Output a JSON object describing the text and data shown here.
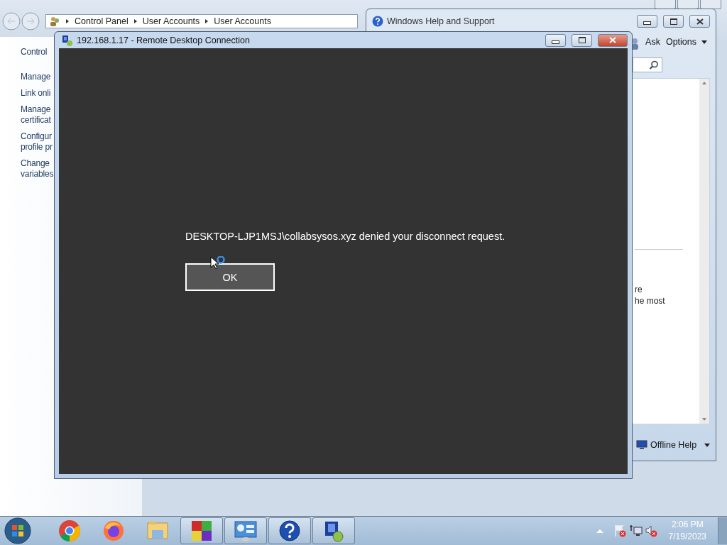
{
  "control_panel": {
    "breadcrumb": [
      "Control Panel",
      "User Accounts",
      "User Accounts"
    ],
    "tasks": [
      {
        "lines": [
          "Control"
        ]
      },
      {
        "lines": [
          "Manage"
        ]
      },
      {
        "lines": [
          "Link onli"
        ]
      },
      {
        "lines": [
          "Manage",
          "certificat"
        ]
      },
      {
        "lines": [
          "Configur",
          "profile pr"
        ]
      },
      {
        "lines": [
          "Change",
          "variables"
        ]
      }
    ]
  },
  "help_window": {
    "title": "Windows Help and Support",
    "toolbar": [
      "Ask",
      "Options"
    ],
    "content_lines": [
      "re",
      "he most"
    ],
    "footer": "Offline Help"
  },
  "rdc_window": {
    "title": "192.168.1.17 - Remote Desktop Connection",
    "message": "DESKTOP-LJP1MSJ\\collabsysos.xyz denied your disconnect request.",
    "button": "OK"
  },
  "taskbar": {
    "apps": [
      {
        "kind": "chrome",
        "running": false
      },
      {
        "kind": "firefox",
        "running": false
      },
      {
        "kind": "folder",
        "running": false
      },
      {
        "kind": "tiles",
        "running": true
      },
      {
        "kind": "panel",
        "running": true
      },
      {
        "kind": "help",
        "running": true
      },
      {
        "kind": "remote",
        "running": true
      }
    ],
    "clock": {
      "time": "2:06 PM",
      "date": "7/19/2023"
    }
  }
}
